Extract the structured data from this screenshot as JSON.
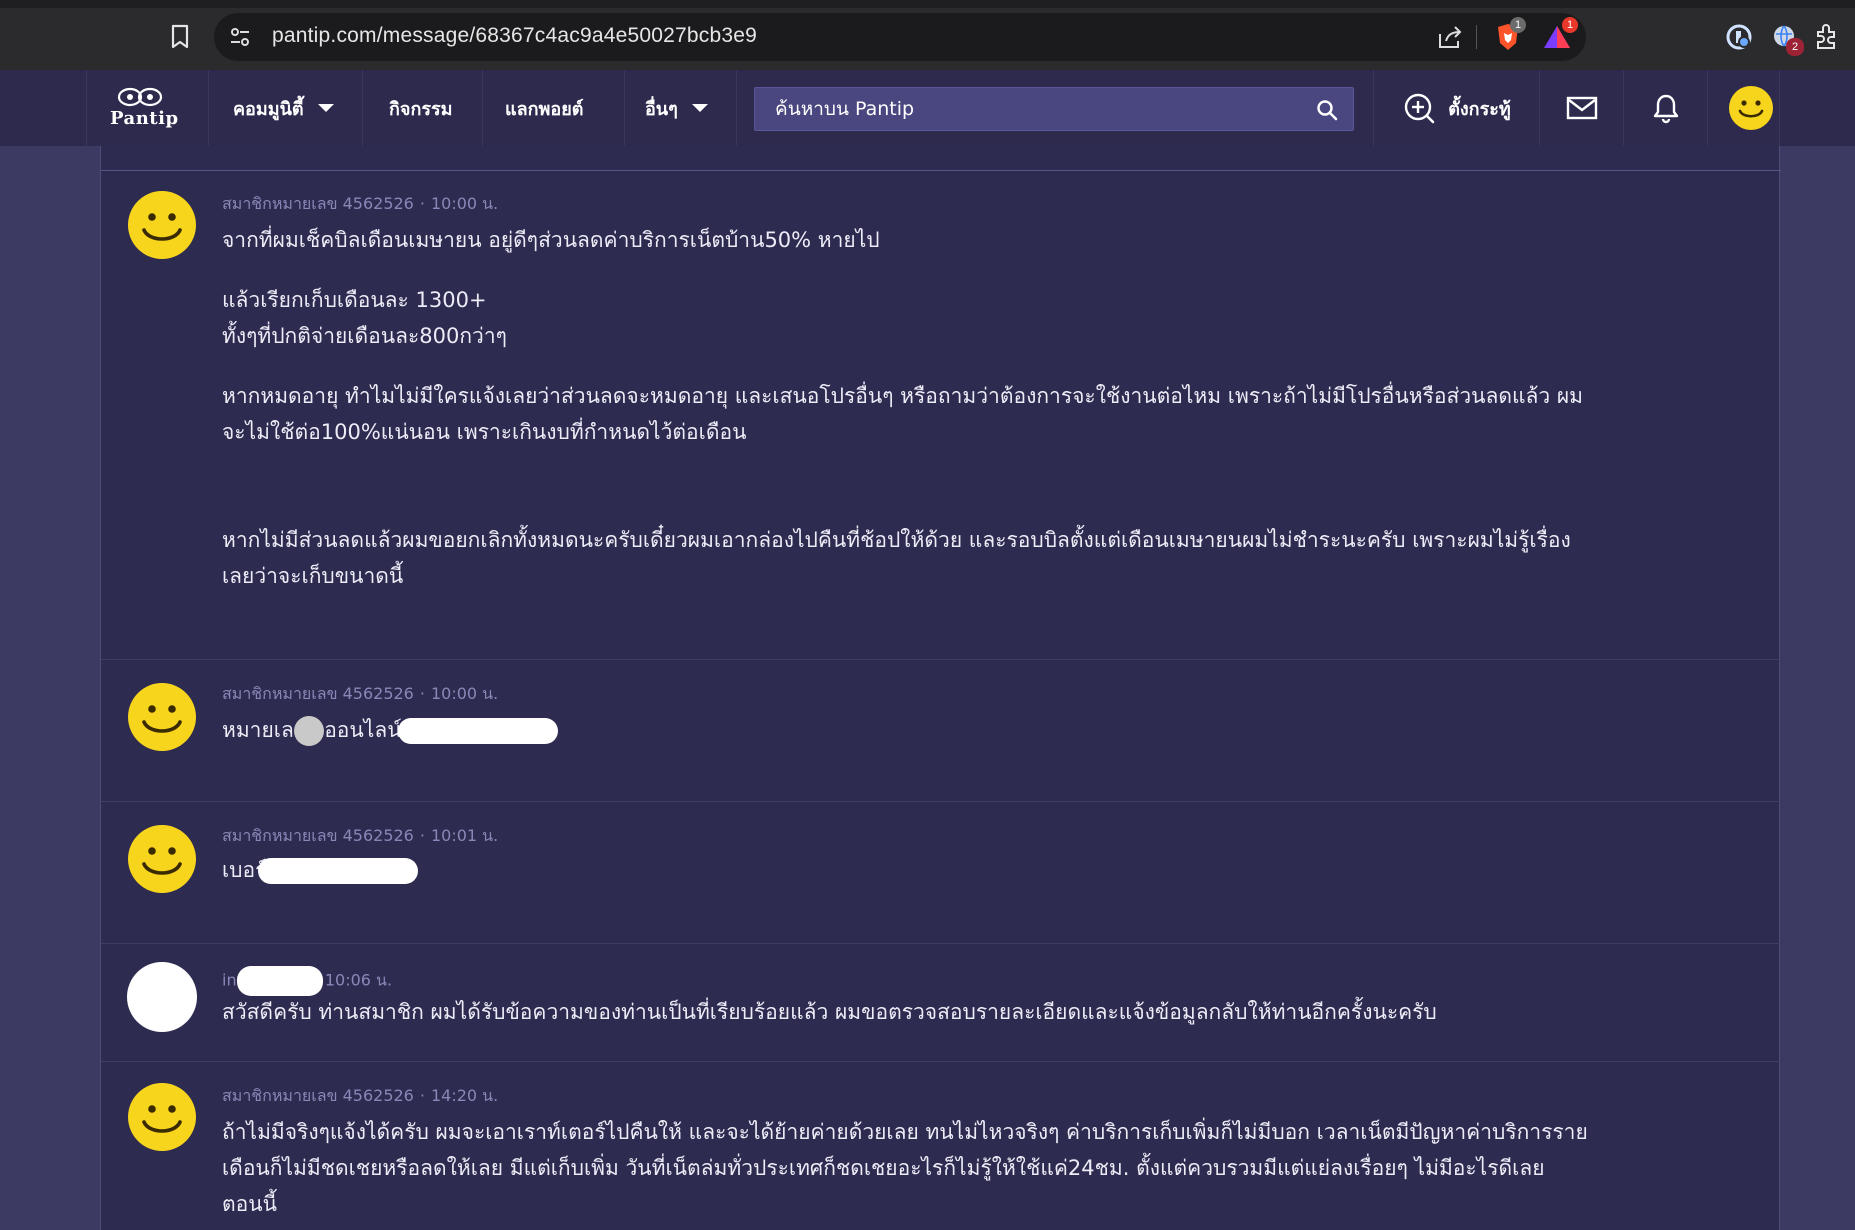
{
  "browser": {
    "url": "pantip.com/message/68367c4ac9a4e50027bcb3e9",
    "brave_badge": "1",
    "rewards_badge": "1",
    "extension_badge": "2"
  },
  "nav": {
    "logo": "Pantip",
    "community": "คอมมูนิตี้",
    "activity": "กิจกรรม",
    "points": "แลกพอยต์",
    "others": "อื่นๆ",
    "search_placeholder": "ค้นหาบน Pantip",
    "post_label": "ตั้งกระทู้"
  },
  "comments": [
    {
      "author": "สมาชิกหมายเลข 4562526",
      "time": "10:00 น.",
      "lines": [
        "จากที่ผมเช็คบิลเดือนเมษายน อยู่ดีๆส่วนลดค่าบริการเน็ตบ้าน50% หายไป",
        "แล้วเรียกเก็บเดือนละ 1300+",
        "ทั้งๆที่ปกติจ่ายเดือนละ800กว่าๆ",
        "หากหมดอายุ ทำไมไม่มีใครแจ้งเลยว่าส่วนลดจะหมดอายุ และเสนอโปรอื่นๆ หรือถามว่าต้องการจะใช้งานต่อไหม เพราะถ้าไม่มีโปรอื่นหรือส่วนลดแล้ว ผม",
        "จะไม่ใช้ต่อ100%แน่นอน เพราะเกินงบที่กำหนดไว้ต่อเดือน",
        "หากไม่มีส่วนลดแล้วผมขอยกเลิกทั้งหมดนะครับเดี๋ยวผมเอากล่องไปคืนที่ช้อปให้ด้วย และรอบบิลตั้งแต่เดือนเมษายนผมไม่ชำระนะครับ เพราะผมไม่รู้เรื่อง",
        "เลยว่าจะเก็บขนาดนี้"
      ]
    },
    {
      "author": "สมาชิกหมายเลข 4562526",
      "time": "10:00 น.",
      "text_a": "หมายเลข",
      "text_b": "ออนไลน์"
    },
    {
      "author": "สมาชิกหมายเลข 4562526",
      "time": "10:01 น.",
      "text_a": "เบอร์"
    },
    {
      "author": "int",
      "time": "10:06 น.",
      "text": "สวัสดีครับ ท่านสมาชิก ผมได้รับข้อความของท่านเป็นที่เรียบร้อยแล้ว ผมขอตรวจสอบรายละเอียดและแจ้งข้อมูลกลับให้ท่านอีกครั้งนะครับ"
    },
    {
      "author": "สมาชิกหมายเลข 4562526",
      "time": "14:20 น.",
      "lines": [
        "ถ้าไม่มีจริงๆแจ้งได้ครับ ผมจะเอาเราท์เตอร์ไปคืนให้ และจะได้ย้ายค่ายด้วยเลย ทนไม่ไหวจริงๆ ค่าบริการเก็บเพิ่มก็ไม่มีบอก เวลาเน็ตมีปัญหาค่าบริการราย",
        "เดือนก็ไม่มีชดเชยหรือลดให้เลย มีแต่เก็บเพิ่ม วันที่เน็ตล่มทั่วประเทศก็ชดเชยอะไรก็ไม่รู้ให้ใช้แค่24ชม. ตั้งแต่ควบรวมมีแต่แย่ลงเรื่อยๆ ไม่มีอะไรดีเลย",
        "ตอนนี้"
      ]
    }
  ],
  "colors": {
    "page_bg": "#3c3963",
    "nav_bg": "#2d2a4e",
    "content_bg": "#2e2b50",
    "avatar_yellow": "#f7d51d"
  },
  "icons": [
    "bookmark-icon",
    "site-settings-icon",
    "share-icon",
    "brave-shields-icon",
    "brave-rewards-icon",
    "search-icon",
    "add-post-icon",
    "mail-icon",
    "bell-icon",
    "smiley-avatar-icon",
    "extensions-icon"
  ]
}
